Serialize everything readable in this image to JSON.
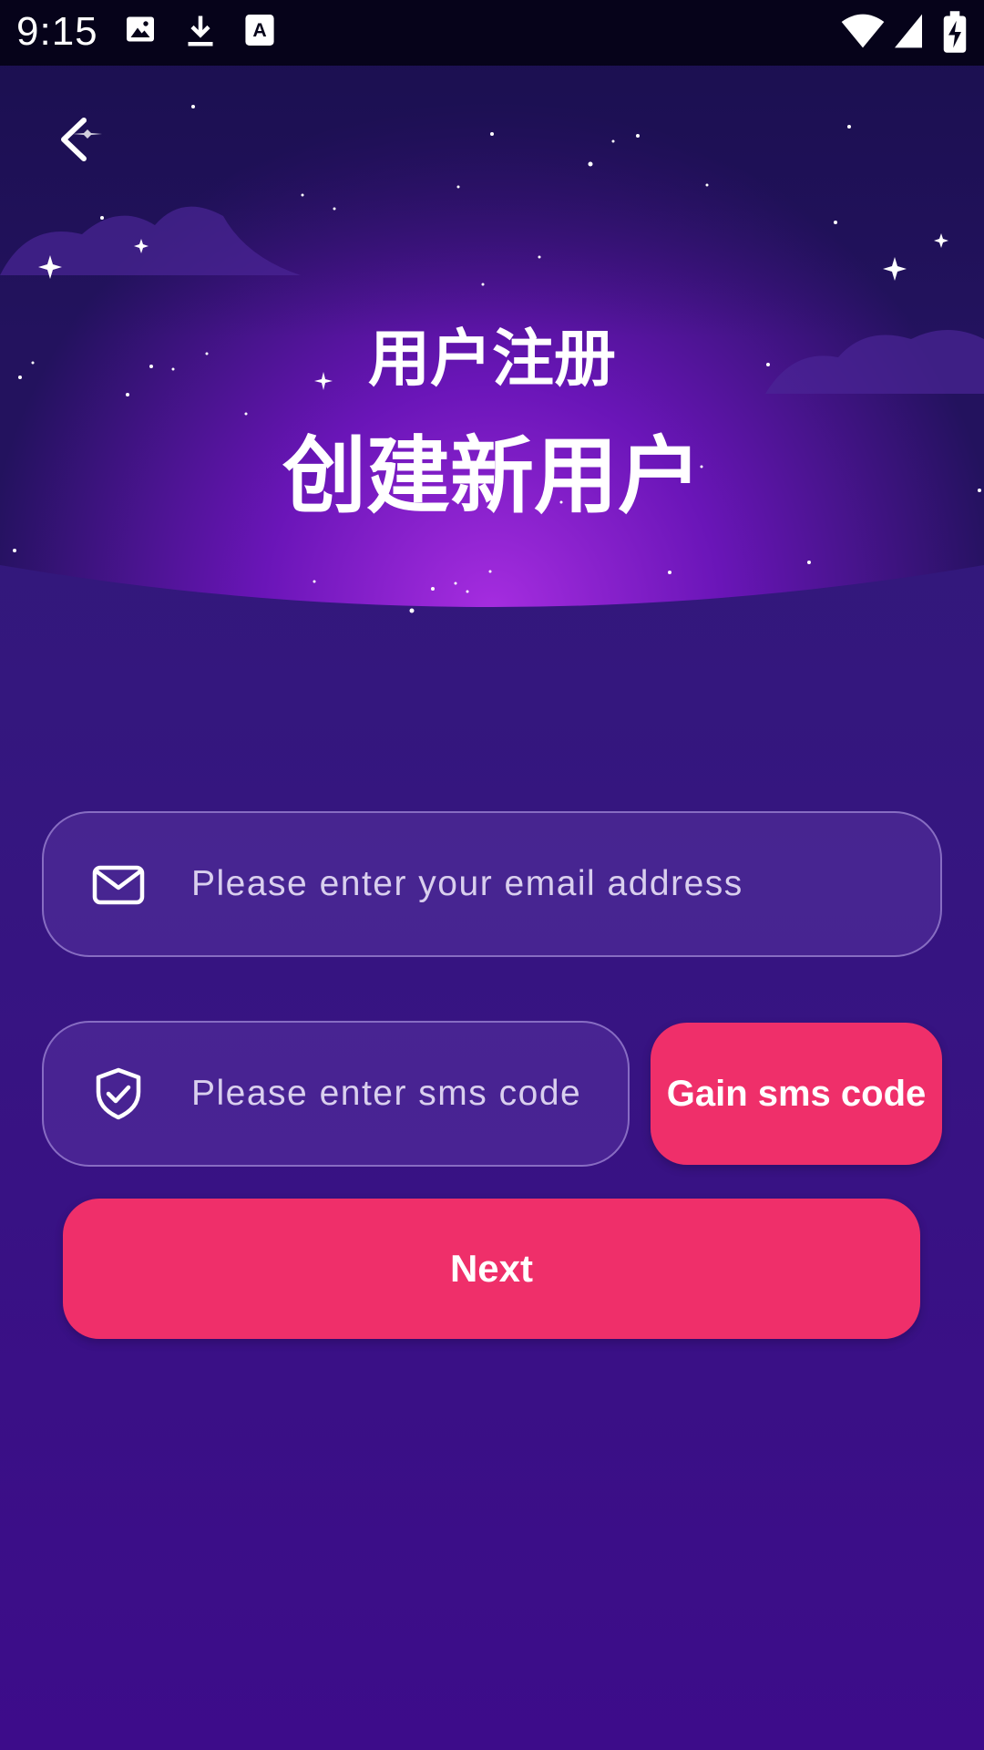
{
  "status_bar": {
    "time": "9:15",
    "left_icons": [
      "image-icon",
      "download-icon",
      "text-recognition-icon"
    ],
    "right_icons": [
      "wifi-icon",
      "signal-icon",
      "battery-charging-icon"
    ]
  },
  "header": {
    "back_icon": "chevron-left-icon",
    "title_small": "用户注册",
    "title_big": "创建新用户"
  },
  "form": {
    "email": {
      "icon": "mail-icon",
      "placeholder": "Please enter your email address",
      "value": ""
    },
    "sms": {
      "icon": "shield-check-icon",
      "placeholder": "Please enter sms code",
      "value": ""
    },
    "gain_sms_label": "Gain sms code",
    "next_label": "Next"
  },
  "colors": {
    "accent": "#ef2f6a",
    "background_top": "#2d1a72",
    "background_bottom": "#3d0c8a",
    "hero_glow": "#9b2de0"
  }
}
